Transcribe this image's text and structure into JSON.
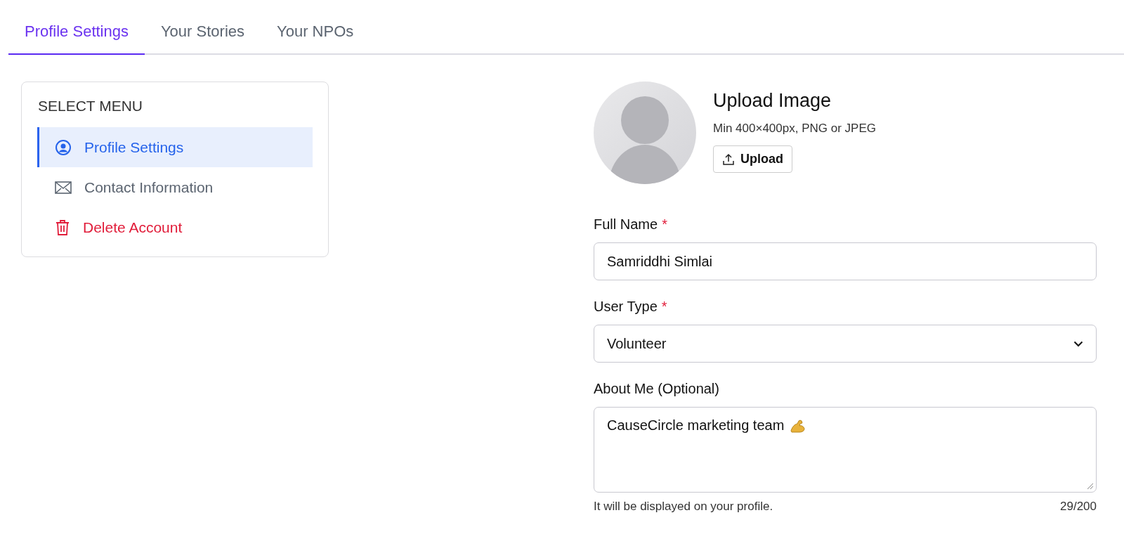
{
  "tabs": [
    {
      "label": "Profile Settings",
      "selected": true
    },
    {
      "label": "Your Stories",
      "selected": false
    },
    {
      "label": "Your NPOs",
      "selected": false
    }
  ],
  "menu": {
    "title": "SELECT MENU",
    "items": [
      {
        "label": "Profile Settings",
        "kind": "profile",
        "selected": true
      },
      {
        "label": "Contact Information",
        "kind": "contact",
        "selected": false
      },
      {
        "label": "Delete Account",
        "kind": "delete",
        "selected": false
      }
    ]
  },
  "upload": {
    "title": "Upload Image",
    "hint": "Min 400×400px, PNG or JPEG",
    "button": "Upload"
  },
  "fields": [
    {
      "kind": "text",
      "label": "Full Name",
      "required_mark": "*",
      "value": "Samriddhi Simlai"
    },
    {
      "kind": "select",
      "label": "User Type",
      "required_mark": "*",
      "value": "Volunteer"
    },
    {
      "kind": "textarea",
      "label": "About Me (Optional)",
      "value": "CauseCircle marketing team",
      "help": "It will be displayed on your profile.",
      "counter": "29/200"
    }
  ]
}
